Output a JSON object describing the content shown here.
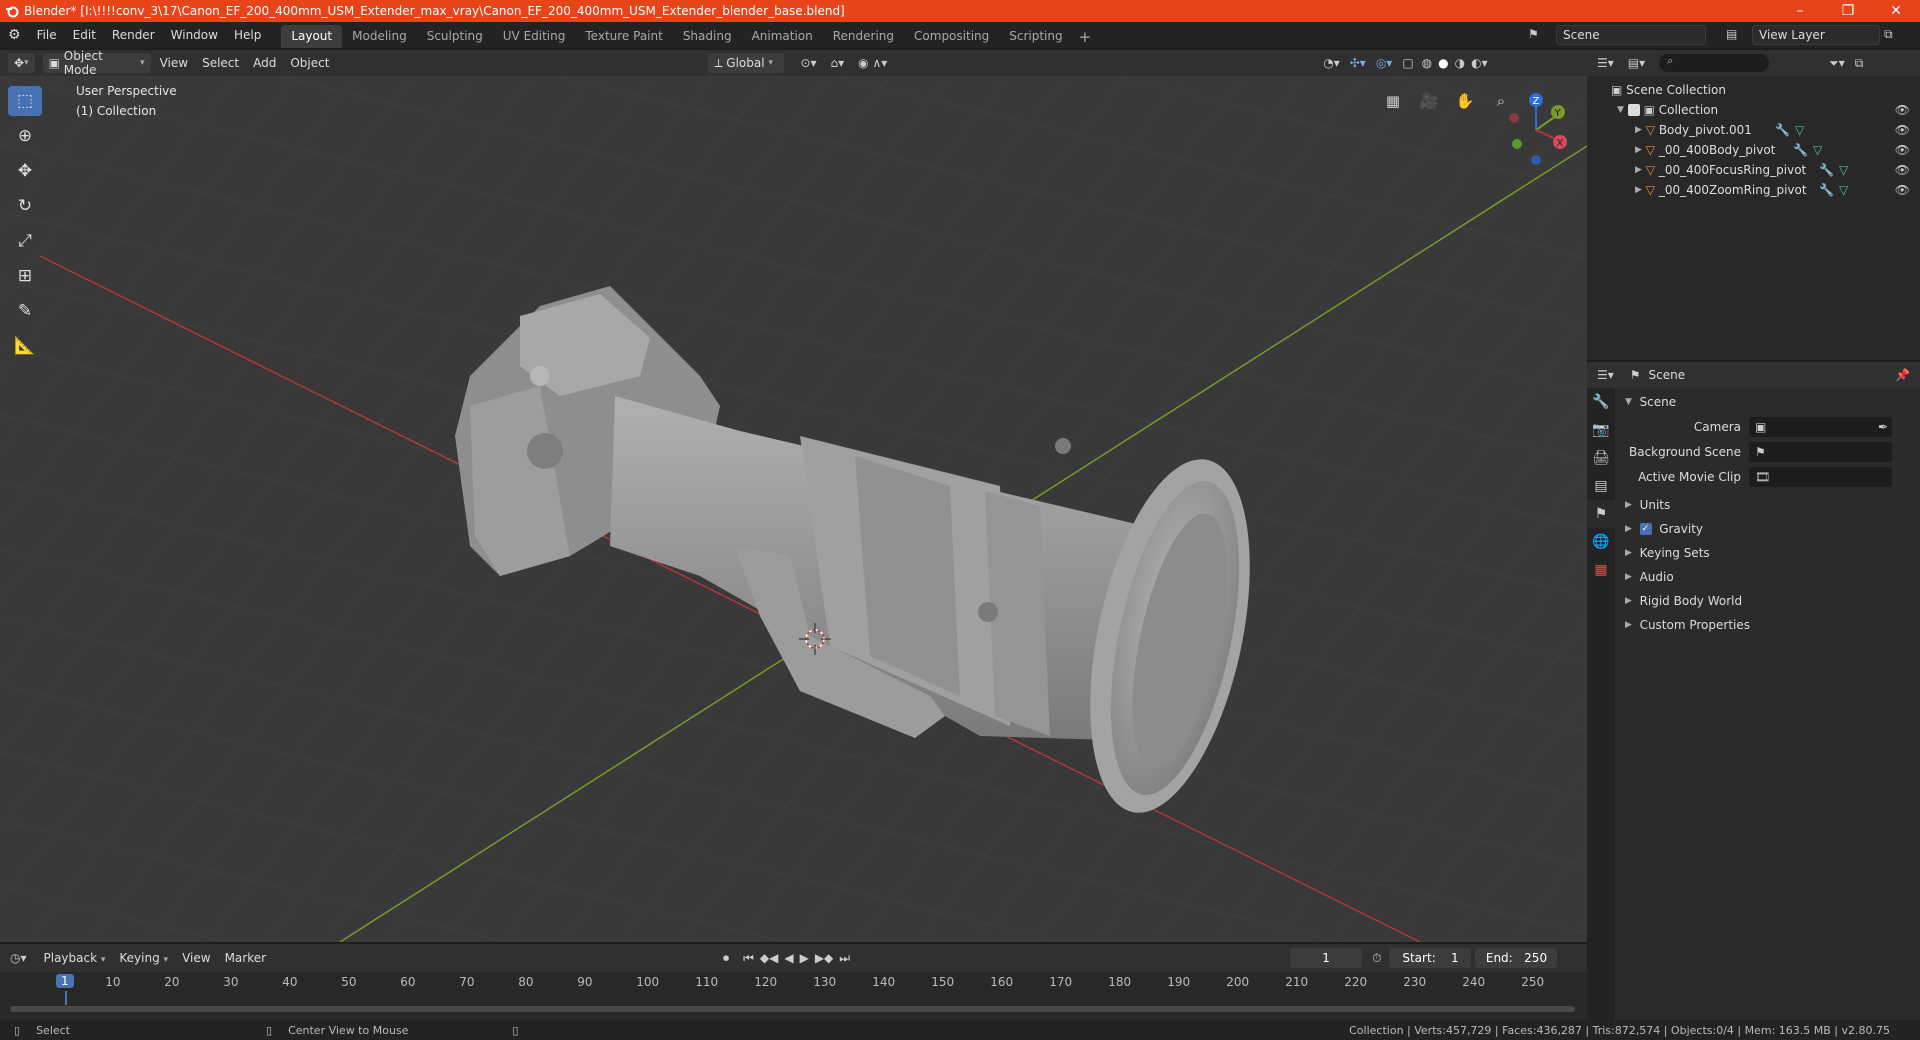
{
  "window": {
    "title": "Blender* [I:\\!!!!conv_3\\17\\Canon_EF_200_400mm_USM_Extender_max_vray\\Canon_EF_200_400mm_USM_Extender_blender_base.blend]",
    "minimize": "–",
    "maximize": "❐",
    "close": "✕"
  },
  "menu": [
    "File",
    "Edit",
    "Render",
    "Window",
    "Help"
  ],
  "workspaces": [
    "Layout",
    "Modeling",
    "Sculpting",
    "UV Editing",
    "Texture Paint",
    "Shading",
    "Animation",
    "Rendering",
    "Compositing",
    "Scripting"
  ],
  "workspace_add": "+",
  "scene_selector": "Scene",
  "view_layer": "View Layer",
  "viewport_header": {
    "mode": "Object Mode",
    "menus": [
      "View",
      "Select",
      "Add",
      "Object"
    ],
    "orientation": "Global"
  },
  "viewport": {
    "perspective": "User Perspective",
    "collection": "(1) Collection",
    "gizmo": {
      "x": "X",
      "y": "Y",
      "z": "Z"
    }
  },
  "toolbar_icons": [
    "select-box-icon",
    "cursor-icon",
    "move-icon",
    "rotate-icon",
    "scale-icon",
    "transform-icon",
    "annotate-icon",
    "measure-icon"
  ],
  "outliner": {
    "root": "Scene Collection",
    "collection": "Collection",
    "items": [
      "Body_pivot.001",
      "_00_400Body_pivot",
      "_00_400FocusRing_pivot",
      "_00_400ZoomRing_pivot"
    ]
  },
  "properties": {
    "header": "Scene",
    "panel": "Scene",
    "camera_label": "Camera",
    "bg_scene_label": "Background Scene",
    "movie_clip_label": "Active Movie Clip",
    "subpanels": [
      "Units",
      "Gravity",
      "Keying Sets",
      "Audio",
      "Rigid Body World",
      "Custom Properties"
    ]
  },
  "timeline": {
    "menus": [
      "Playback",
      "Keying",
      "View",
      "Marker"
    ],
    "current_frame": "1",
    "start_label": "Start:",
    "start": "1",
    "end_label": "End:",
    "end": "250",
    "ruler": [
      "1",
      "10",
      "20",
      "30",
      "40",
      "50",
      "60",
      "70",
      "80",
      "90",
      "100",
      "110",
      "120",
      "130",
      "140",
      "150",
      "160",
      "170",
      "180",
      "190",
      "200",
      "210",
      "220",
      "230",
      "240",
      "250"
    ]
  },
  "status": {
    "select": "Select",
    "center": "Center View to Mouse",
    "stats": "Collection | Verts:457,729 | Faces:436,287 | Tris:872,574 | Objects:0/4 | Mem: 163.5 MB | v2.80.75"
  },
  "colors": {
    "titlebar": "#e8441a",
    "accent": "#4772b3",
    "x_axis": "#b3373f",
    "y_axis": "#7a9a2a",
    "model": "#9a9a9a"
  }
}
